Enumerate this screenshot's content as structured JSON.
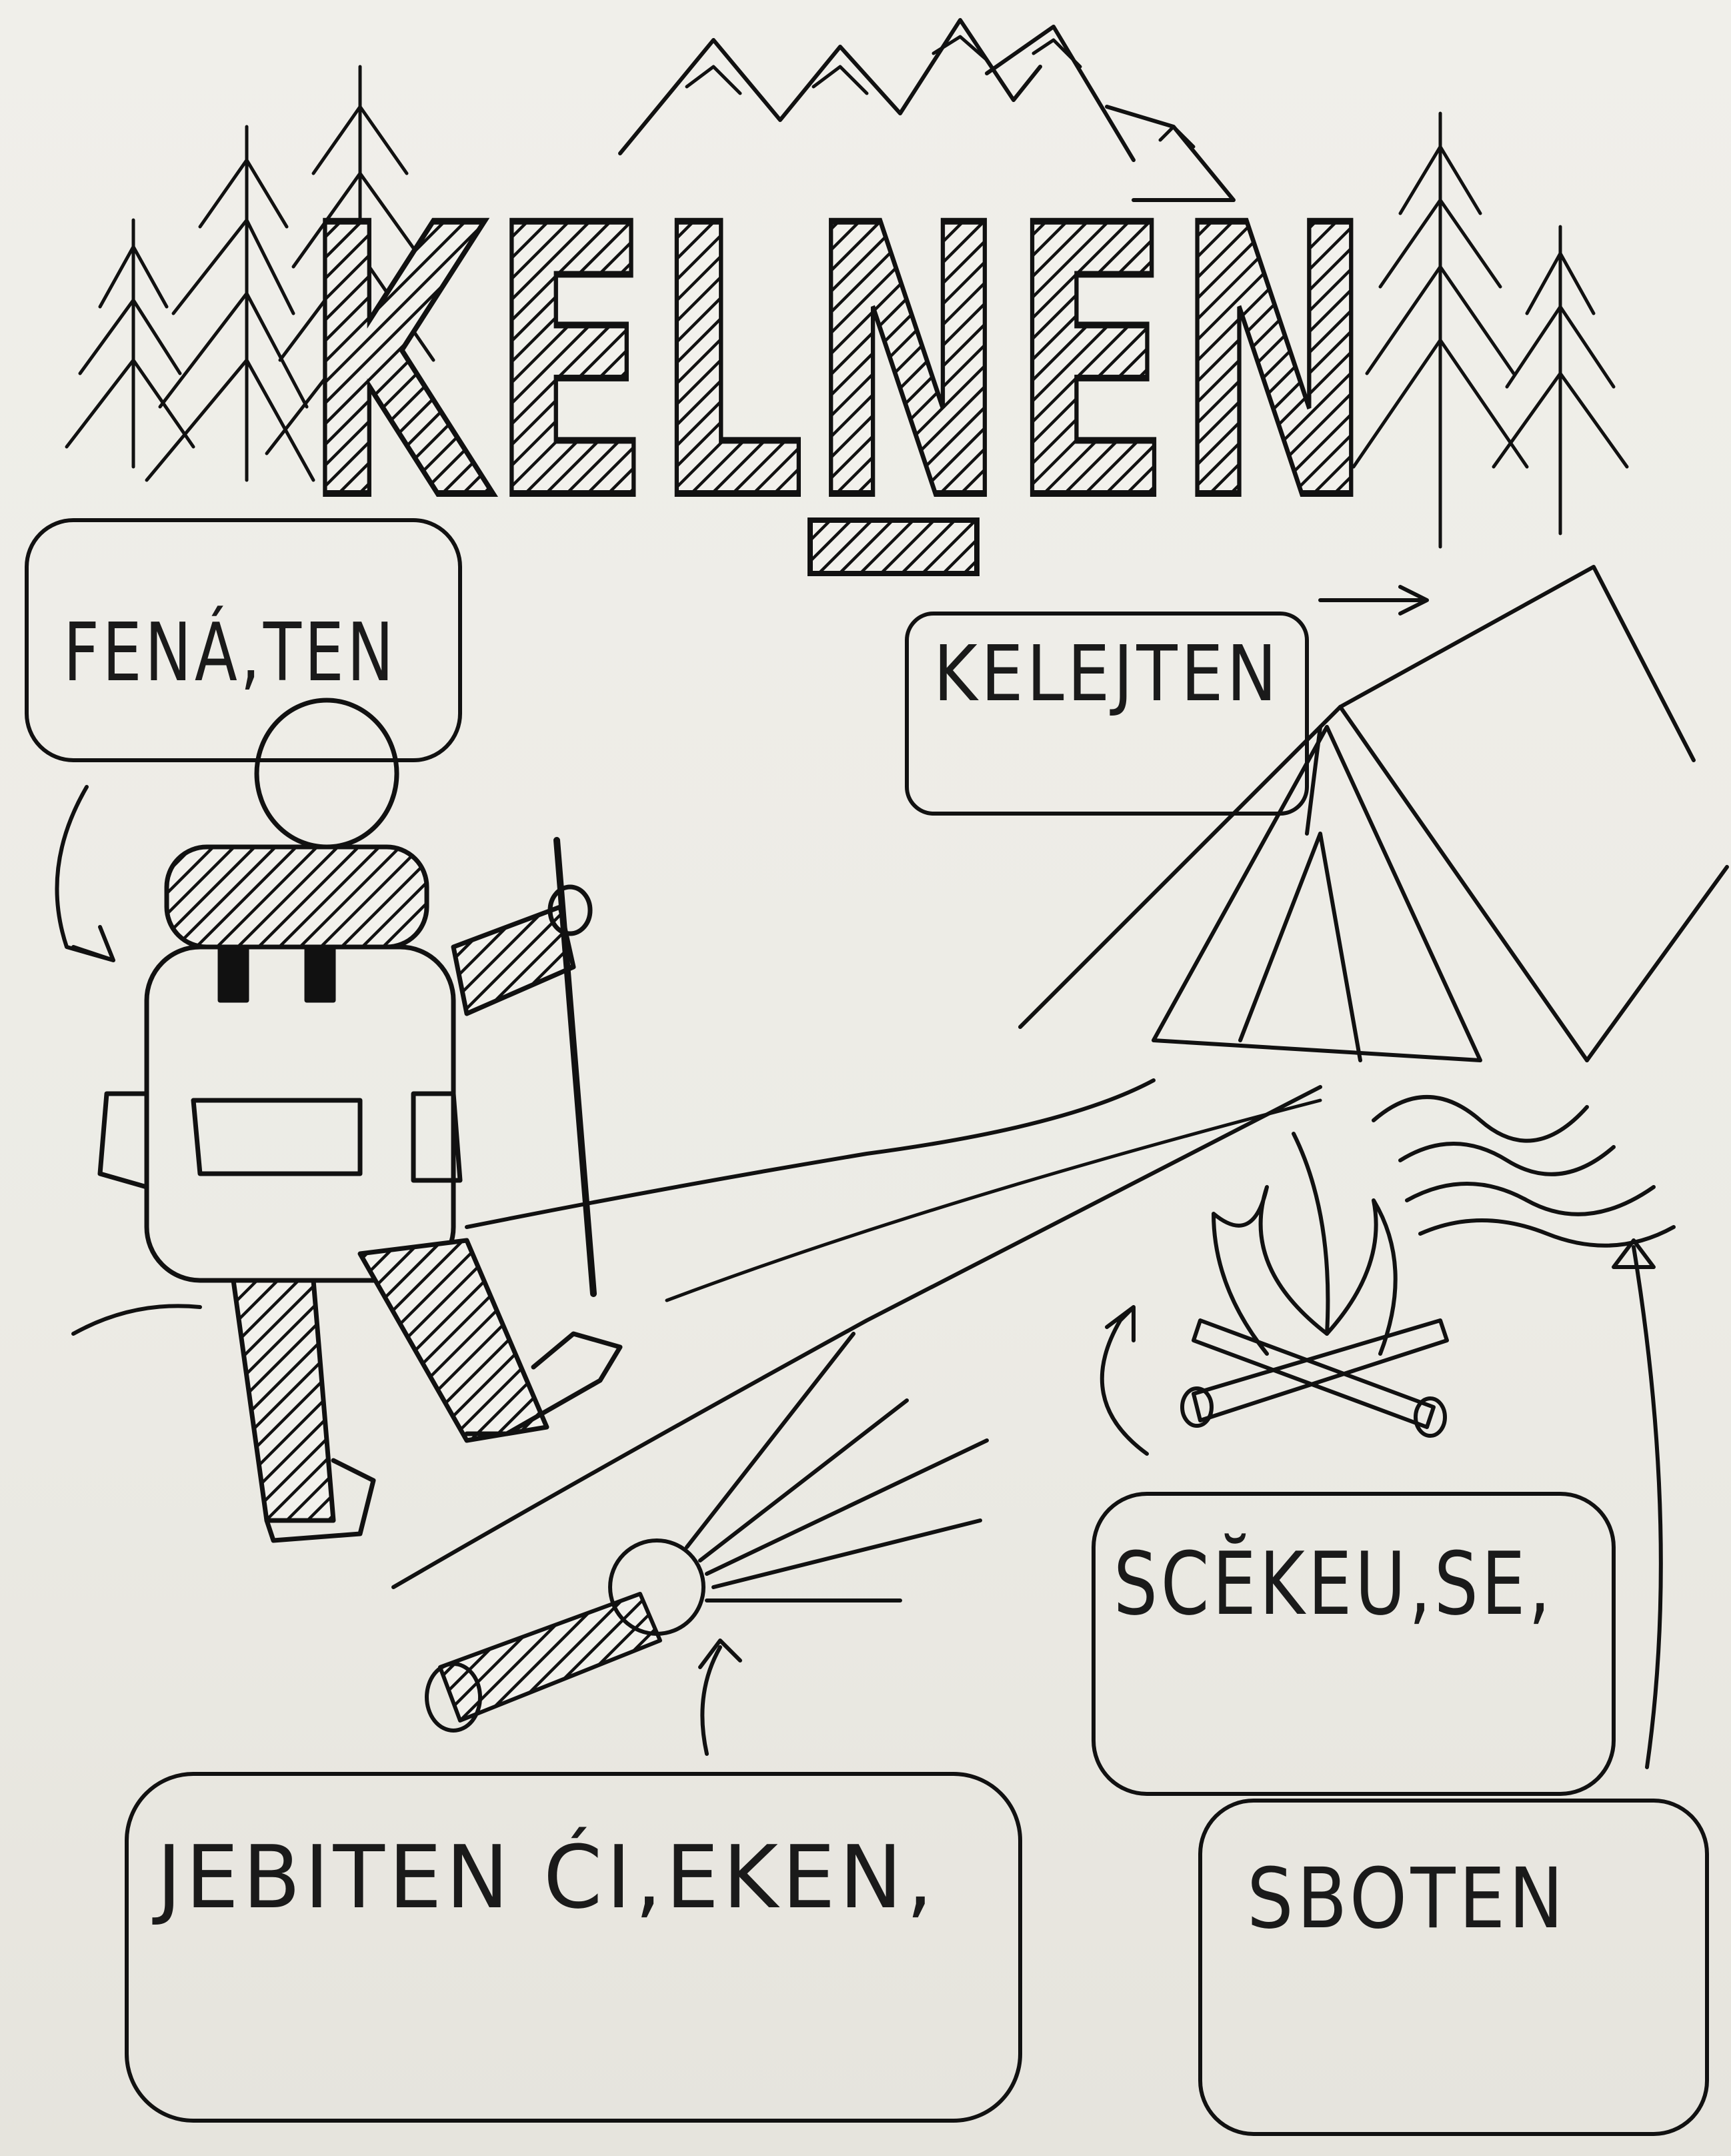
{
  "title": "KELNEN",
  "labels": {
    "walker": "FENÁ,TEN",
    "tent": "KELEJTEN",
    "fire": "SCĔKEU,SE,",
    "flashlight": "JEBITEN ĆI,EKEN,",
    "water": "SBOTEN"
  },
  "colors": {
    "ink": "#111111",
    "paper": "#eeede8"
  }
}
